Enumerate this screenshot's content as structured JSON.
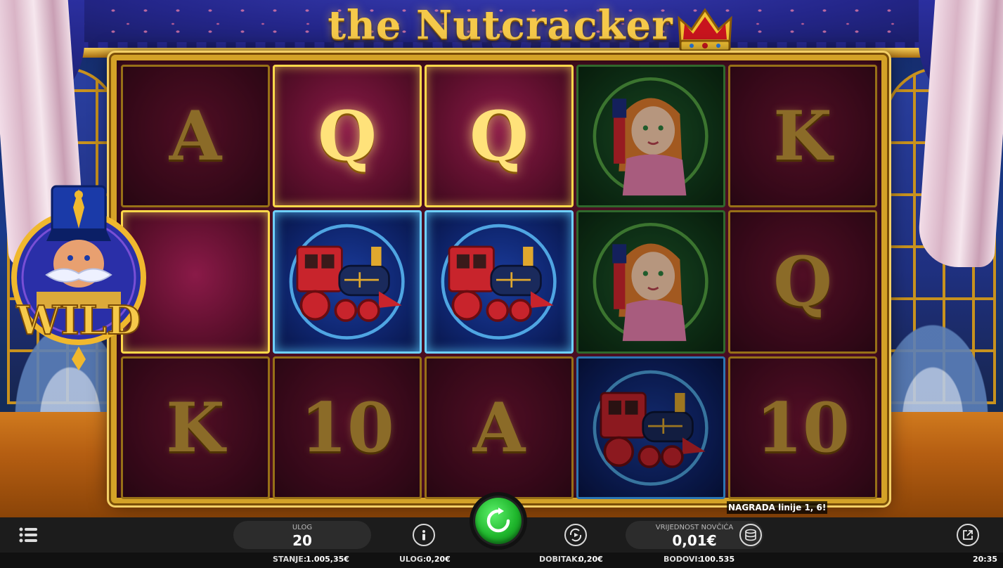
{
  "game": {
    "title": "the Nutcracker"
  },
  "reels": [
    [
      {
        "symbol": "A",
        "state": "dim"
      },
      {
        "symbol": "WILD",
        "state": "win"
      },
      {
        "symbol": "K",
        "state": "dim"
      }
    ],
    [
      {
        "symbol": "Q",
        "state": "win"
      },
      {
        "symbol": "train",
        "state": "win"
      },
      {
        "symbol": "10",
        "state": "dim"
      }
    ],
    [
      {
        "symbol": "Q",
        "state": "win"
      },
      {
        "symbol": "train",
        "state": "win"
      },
      {
        "symbol": "A",
        "state": "dim"
      }
    ],
    [
      {
        "symbol": "girl",
        "state": "dim"
      },
      {
        "symbol": "girl",
        "state": "dim"
      },
      {
        "symbol": "train",
        "state": "dim"
      }
    ],
    [
      {
        "symbol": "K",
        "state": "dim"
      },
      {
        "symbol": "Q",
        "state": "dim"
      },
      {
        "symbol": "10",
        "state": "dim"
      }
    ]
  ],
  "symbols": {
    "wild_label": "WILD"
  },
  "win_message": "NAGRADA linije 1, 6!",
  "controls": {
    "bet_label": "ULOG",
    "bet_value": "20",
    "coin_value_label": "VRIJEDNOST NOVČIĆA",
    "coin_value": "0,01€"
  },
  "status": {
    "balance_label": "STANJE:",
    "balance_value": "1.005,35€",
    "bet_label": "ULOG:",
    "bet_value": "0,20€",
    "win_label": "DOBITAK:",
    "win_value": "0,20€",
    "points_label": "BODOVI:",
    "points_value": "100.535",
    "clock": "20:35"
  },
  "icons": [
    "menu-icon",
    "info-icon",
    "spin-icon",
    "autoplay-icon",
    "coins-icon",
    "external-link-icon",
    "crown-icon"
  ],
  "colors": {
    "gold": "#d4a227",
    "spin_green": "#1fb62c",
    "reel_bg": "#5c0f2c"
  }
}
